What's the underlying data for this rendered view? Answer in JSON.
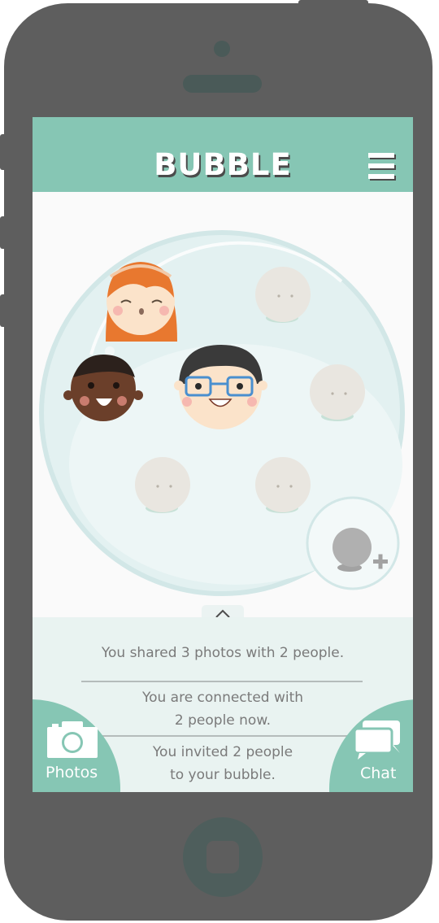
{
  "app": {
    "title": "BUBBLE",
    "menu_icon": "hamburger-menu-icon"
  },
  "bubble": {
    "members": [
      {
        "name": "avatar-girl",
        "state": "joined"
      },
      {
        "name": "avatar-boy",
        "state": "joined"
      },
      {
        "name": "avatar-man-glasses",
        "state": "joined"
      }
    ],
    "empty_slots": 5,
    "add_icon": "add-person-icon"
  },
  "drawer": {
    "toggle_icon": "chevron-up-icon"
  },
  "activity": [
    {
      "lines": [
        "You shared 3 photos with 2 people."
      ]
    },
    {
      "lines": [
        "You are connected with",
        "2 people now."
      ]
    },
    {
      "lines": [
        "You invited 2 people",
        "to your bubble."
      ]
    }
  ],
  "actions": {
    "photos": {
      "label": "Photos",
      "icon": "camera-icon"
    },
    "chat": {
      "label": "Chat",
      "icon": "chat-icon"
    }
  },
  "colors": {
    "brand": "#86c6b4",
    "phone_body": "#5e5e5e",
    "panel": "#e9f3f1",
    "text": "#7a7a7a"
  }
}
